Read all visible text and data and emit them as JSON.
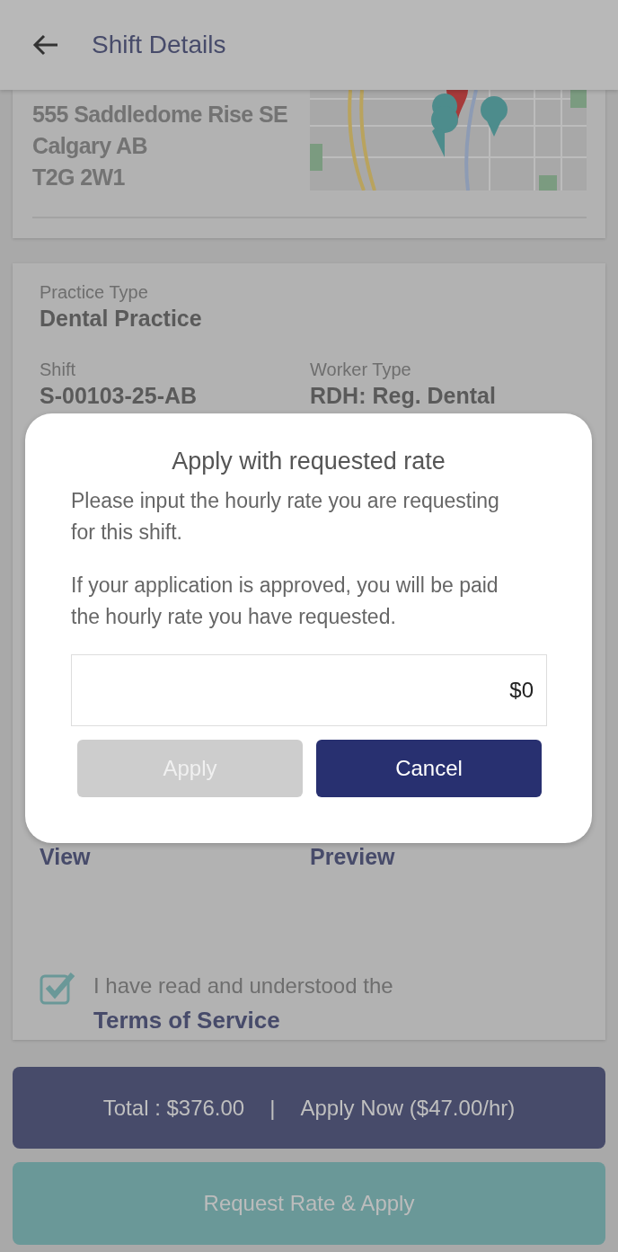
{
  "header": {
    "title": "Shift Details"
  },
  "address_card": {
    "lines": [
      "555 Saddledome Rise SE",
      "Calgary AB",
      "T2G 2W1"
    ]
  },
  "details_card": {
    "fields": [
      {
        "label": "Practice Type",
        "value": "Dental Practice"
      },
      {
        "label": "Shift",
        "value": "S-00103-25-AB"
      },
      {
        "label": "Worker Type",
        "value": "RDH: Reg. Dental"
      }
    ],
    "links": [
      "View",
      "Preview"
    ],
    "terms": {
      "checked": true,
      "text": "I have read and understood the",
      "link": "Terms of Service"
    }
  },
  "footer": {
    "total": "Total : $376.00",
    "separator": "|",
    "apply_now": "Apply Now ($47.00/hr)",
    "request_button": "Request Rate & Apply"
  },
  "dialog": {
    "title": "Apply with requested rate",
    "paragraphs": [
      "Please input the hourly rate you are requesting for this shift.",
      "If your application is approved, you will be paid the hourly rate you have requested."
    ],
    "rate_field": {
      "value": "$0"
    },
    "buttons": [
      {
        "label": "Apply",
        "disabled": true
      },
      {
        "label": "Cancel",
        "disabled": false
      }
    ]
  }
}
